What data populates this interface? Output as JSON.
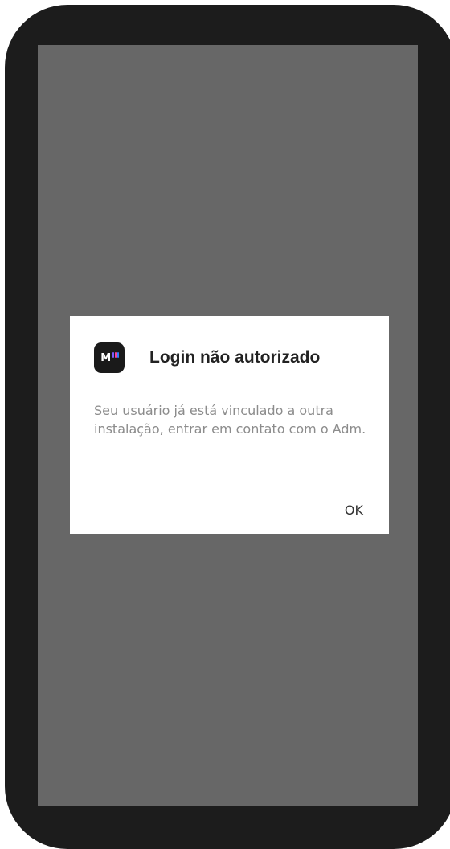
{
  "dialog": {
    "title": "Login não autorizado",
    "message": "Seu usuário já está vinculado a outra instalação, entrar em contato com o Adm.",
    "ok_label": "OK"
  },
  "app_icon": {
    "name": "app-logo-icon",
    "letter": "M",
    "bar_colors": [
      "#7b5cff",
      "#ff3d9a",
      "#2f7dff"
    ]
  },
  "colors": {
    "frame": "#1c1c1c",
    "scrim": "#676767",
    "dialog_bg": "#ffffff",
    "title": "#222222",
    "message": "#8c8c8c"
  }
}
